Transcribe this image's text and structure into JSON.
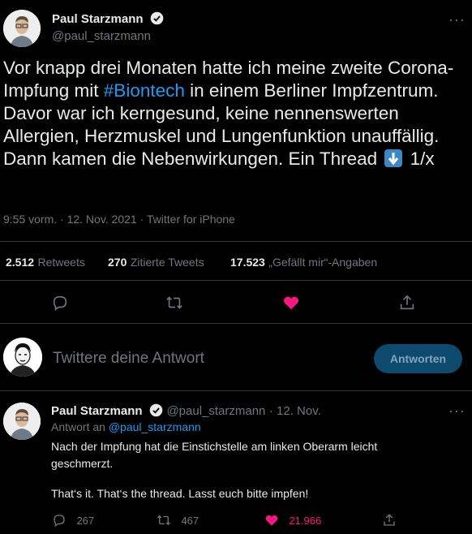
{
  "main_tweet": {
    "author_name": "Paul Starzmann",
    "author_handle": "@paul_starzmann",
    "text_before": "Vor knapp drei Monaten hatte ich meine zweite Corona-Impfung mit ",
    "hashtag": "#Biontech",
    "text_after": " in einem Berliner Impfzentrum. Davor war ich kerngesund, keine nennenswerten Allergien, Herzmuskel und Lungenfunktion unauffällig. Dann kamen die Nebenwirkungen. Ein Thread",
    "text_end": "1/x",
    "emoji": "down-arrow-emoji",
    "timestamp": "9:55 vorm. · 12. Nov. 2021 · Twitter for iPhone",
    "stats": {
      "retweets_count": "2.512",
      "retweets_label": "Retweets",
      "quotes_count": "270",
      "quotes_label": "Zitierte Tweets",
      "likes_count": "17.523",
      "likes_label": "„Gefällt mir“-Angaben"
    },
    "more_label": "···"
  },
  "reply_box": {
    "placeholder": "Twittere deine Antwort",
    "button_label": "Antworten"
  },
  "reply_tweet": {
    "author_name": "Paul Starzmann",
    "author_handle": "@paul_starzmann",
    "date": "· 12. Nov.",
    "reply_to_prefix": "Antwort an",
    "reply_to_handle": "@paul_starzmann",
    "line1": "Nach der Impfung hat die Einstichstelle am linken Oberarm leicht",
    "line2": "geschmerzt.",
    "line3": "That‘s it. That‘s the thread. Lasst euch bitte impfen!",
    "reply_count": "267",
    "retweet_count": "467",
    "like_count": "21.966",
    "more_label": "···"
  },
  "colors": {
    "background": "#000000",
    "text": "#e7e9ea",
    "muted": "#71767b",
    "accent": "#1d9bf0",
    "like": "#f91880",
    "divider": "#2f3336"
  }
}
